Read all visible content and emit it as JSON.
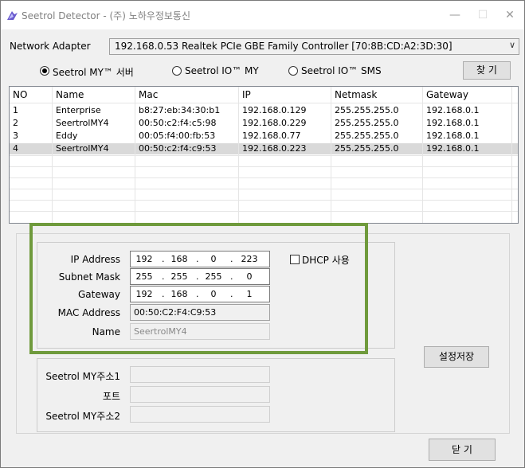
{
  "window": {
    "title": "Seetrol Detector - (주) 노하우정보통신",
    "minimize": "—",
    "maximize": "☐",
    "close": "✕"
  },
  "network": {
    "label": "Network Adapter",
    "value": "192.168.0.53    Realtek PCIe GBE Family Controller [70:8B:CD:A2:3D:30]",
    "arrow": "∨"
  },
  "radios": [
    {
      "label": "Seetrol MY™ 서버",
      "selected": true
    },
    {
      "label": "Seetrol IO™ MY",
      "selected": false
    },
    {
      "label": "Seetrol IO™ SMS",
      "selected": false
    }
  ],
  "search_button": "찾 기",
  "table": {
    "columns": [
      "NO",
      "Name",
      "Mac",
      "IP",
      "Netmask",
      "Gateway"
    ],
    "rows": [
      [
        "1",
        "Enterprise",
        "b8:27:eb:34:30:b1",
        "192.168.0.129",
        "255.255.255.0",
        "192.168.0.1"
      ],
      [
        "2",
        "SeertrolMY4",
        "00:50:c2:f4:c5:98",
        "192.168.0.229",
        "255.255.255.0",
        "192.168.0.1"
      ],
      [
        "3",
        "Eddy",
        "00:05:f4:00:fb:53",
        "192.168.0.77",
        "255.255.255.0",
        "192.168.0.1"
      ],
      [
        "4",
        "SeertrolMY4",
        "00:50:c2:f4:c9:53",
        "192.168.0.223",
        "255.255.255.0",
        "192.168.0.1"
      ]
    ],
    "selected_row": 3
  },
  "form": {
    "ip_label": "IP Address",
    "ip": [
      "192",
      "168",
      "0",
      "223"
    ],
    "subnet_label": "Subnet Mask",
    "subnet": [
      "255",
      "255",
      "255",
      "0"
    ],
    "gateway_label": "Gateway",
    "gateway": [
      "192",
      "168",
      "0",
      "1"
    ],
    "mac_label": "MAC Address",
    "mac": "00:50:C2:F4:C9:53",
    "name_label": "Name",
    "name": "SeertrolMY4",
    "dhcp_label": "DHCP 사용",
    "dot": "."
  },
  "save_button": "설정저장",
  "server": {
    "addr1_label": "Seetrol MY주소1",
    "port_label": "포트",
    "addr2_label": "Seetrol MY주소2"
  },
  "close_button": "닫 기",
  "colors": {
    "highlight": "#6f9a3c",
    "selection": "#d9d9d9"
  }
}
